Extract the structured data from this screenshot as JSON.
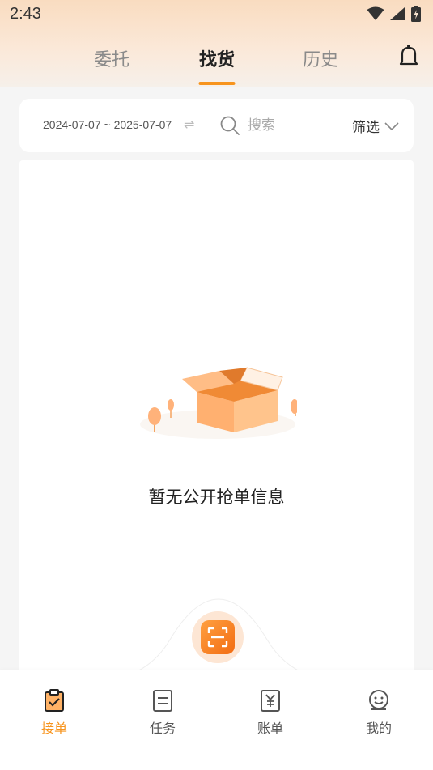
{
  "status_bar": {
    "time": "2:43"
  },
  "tabs": [
    {
      "label": "委托",
      "active": false
    },
    {
      "label": "找货",
      "active": true
    },
    {
      "label": "历史",
      "active": false
    }
  ],
  "filter": {
    "date_range": "2024-07-07 ~ 2025-07-07",
    "search_placeholder": "搜索",
    "filter_label": "筛选"
  },
  "empty_state": {
    "message": "暂无公开抢单信息"
  },
  "bottom_nav": [
    {
      "label": "接单",
      "icon": "clipboard-check-icon",
      "active": true
    },
    {
      "label": "任务",
      "icon": "task-list-icon",
      "active": false
    },
    {
      "label": "账单",
      "icon": "bill-yuan-icon",
      "active": false
    },
    {
      "label": "我的",
      "icon": "profile-icon",
      "active": false
    }
  ],
  "colors": {
    "accent": "#f7941d",
    "header_top": "#f9dcc0",
    "background": "#f5f5f5"
  }
}
